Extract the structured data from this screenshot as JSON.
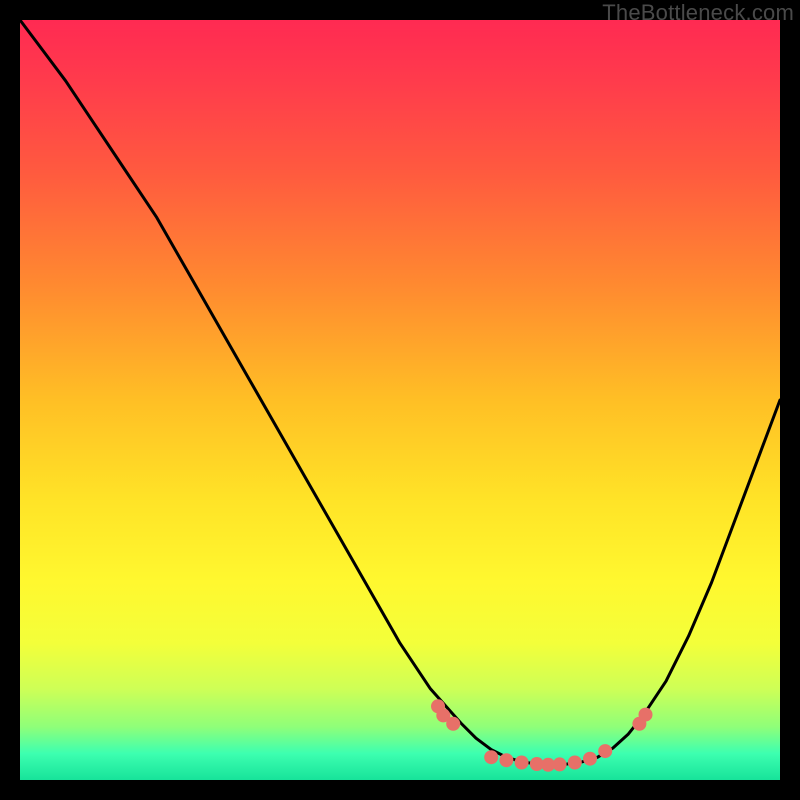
{
  "watermark": "TheBottleneck.com",
  "colors": {
    "background": "#000000",
    "curve": "#000000",
    "marker_fill": "#e77068",
    "gradient_stops": [
      {
        "offset": 0.0,
        "color": "#ff2a52"
      },
      {
        "offset": 0.08,
        "color": "#ff3b4c"
      },
      {
        "offset": 0.2,
        "color": "#ff5a3f"
      },
      {
        "offset": 0.35,
        "color": "#ff8a30"
      },
      {
        "offset": 0.5,
        "color": "#ffbf25"
      },
      {
        "offset": 0.63,
        "color": "#ffe327"
      },
      {
        "offset": 0.74,
        "color": "#fff82f"
      },
      {
        "offset": 0.82,
        "color": "#f3ff3a"
      },
      {
        "offset": 0.88,
        "color": "#ceff56"
      },
      {
        "offset": 0.93,
        "color": "#8fff79"
      },
      {
        "offset": 0.965,
        "color": "#3dffb0"
      },
      {
        "offset": 1.0,
        "color": "#17e39a"
      }
    ]
  },
  "chart_data": {
    "type": "line",
    "title": "",
    "xlabel": "",
    "ylabel": "",
    "xlim": [
      0,
      100
    ],
    "ylim": [
      0,
      100
    ],
    "series": [
      {
        "name": "bottleneck-curve",
        "x": [
          0,
          3,
          6,
          10,
          14,
          18,
          22,
          26,
          30,
          34,
          38,
          42,
          46,
          50,
          54,
          58,
          60,
          62,
          64,
          66,
          68,
          70,
          72,
          74,
          76,
          78,
          80,
          82,
          85,
          88,
          91,
          94,
          97,
          100
        ],
        "y_pct_from_top": [
          0,
          4,
          8,
          14,
          20,
          26,
          33,
          40,
          47,
          54,
          61,
          68,
          75,
          82,
          88,
          92.5,
          94.5,
          96,
          97,
          97.6,
          97.9,
          98,
          97.9,
          97.6,
          97,
          95.8,
          94,
          91.5,
          87,
          81,
          74,
          66,
          58,
          50
        ]
      }
    ],
    "markers": {
      "name": "highlight-points",
      "x": [
        55,
        55.7,
        57,
        62,
        64,
        66,
        68,
        69.5,
        71,
        73,
        75,
        77,
        81.5,
        82.3
      ],
      "y_pct_from_top": [
        90.3,
        91.5,
        92.6,
        97,
        97.4,
        97.7,
        97.9,
        98,
        97.95,
        97.7,
        97.2,
        96.2,
        92.6,
        91.4
      ],
      "r": 7
    }
  }
}
